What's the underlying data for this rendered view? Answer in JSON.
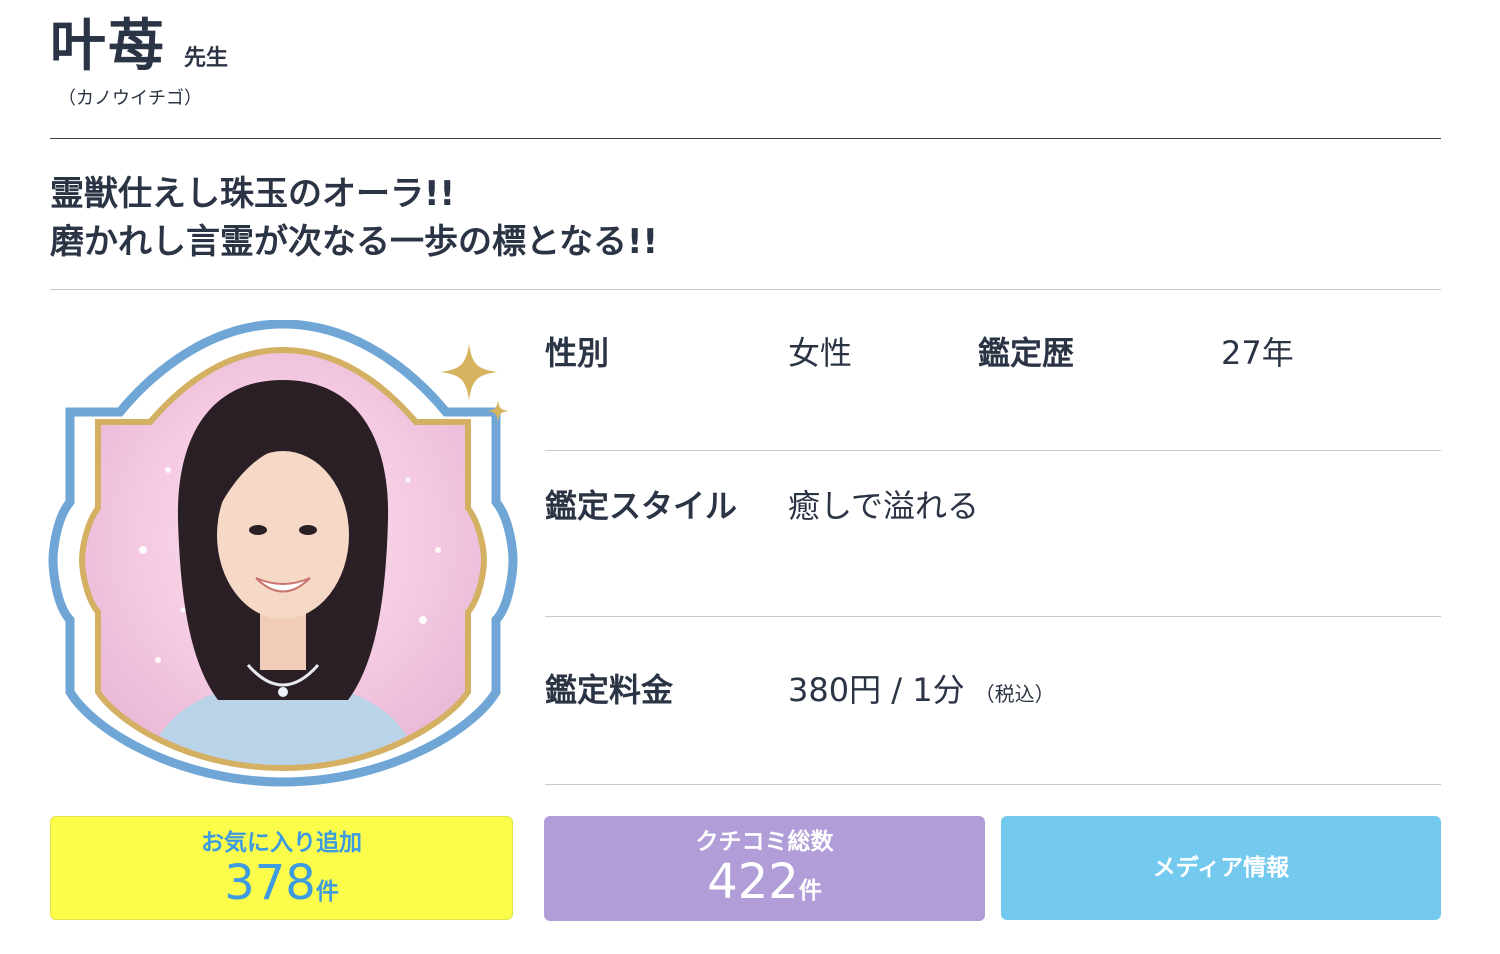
{
  "profile": {
    "name": "叶苺",
    "honorific": "先生",
    "reading": "（カノウイチゴ）",
    "catchphrase": [
      "霊獣仕えし珠玉のオーラ!!",
      "磨かれし言霊が次なる一歩の標となる!!"
    ]
  },
  "details": {
    "gender_label": "性別",
    "gender_value": "女性",
    "experience_label": "鑑定歴",
    "experience_value": "27年",
    "style_label": "鑑定スタイル",
    "style_value": "癒しで溢れる",
    "fee_label": "鑑定料金",
    "fee_value": "380円 / 1分",
    "fee_note": "（税込）"
  },
  "actions": {
    "favorite": {
      "label": "お気に入り追加",
      "count": "378",
      "unit": "件"
    },
    "reviews": {
      "label": "クチコミ総数",
      "count": "422",
      "unit": "件"
    },
    "media": {
      "label": "メディア情報"
    }
  },
  "colors": {
    "text": "#2b3445",
    "favorite_bg": "#fcfc4a",
    "favorite_text": "#3d9be0",
    "reviews_bg": "#b19ed8",
    "media_bg": "#74c9ef",
    "frame_blue": "#6fa6d6",
    "frame_gold": "#d4b062"
  },
  "icons": [
    "sparkle-icon"
  ]
}
